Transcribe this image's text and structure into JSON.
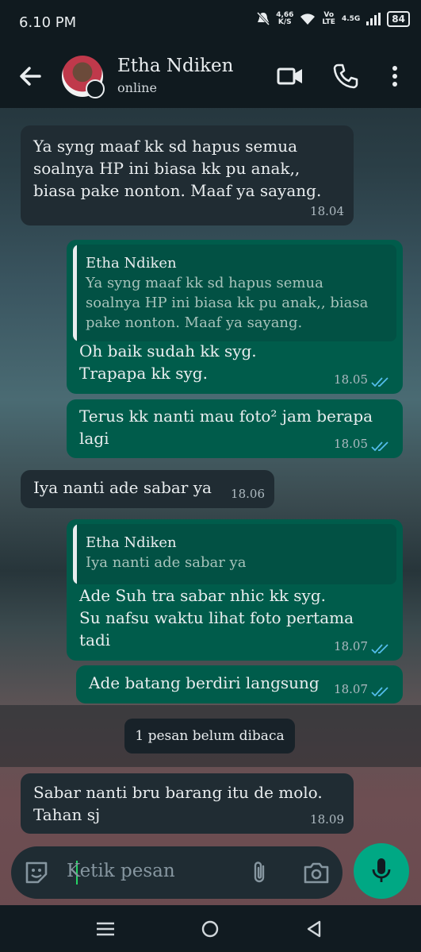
{
  "status_bar": {
    "time": "6.10 PM",
    "net_speed_value": "4,66",
    "net_speed_unit": "K/S",
    "vo_label": "Vo",
    "lte_label": "LTE",
    "signal_label": "4.5G",
    "battery": "84"
  },
  "header": {
    "contact_name": "Etha Ndiken",
    "contact_status": "online"
  },
  "messages": [
    {
      "direction": "in",
      "text": "Ya syng maaf kk sd hapus semua\nsoalnya HP ini biasa kk pu anak,,\nbiasa pake nonton. Maaf ya sayang.",
      "time": "18.04"
    },
    {
      "direction": "out",
      "quote_name": "Etha Ndiken",
      "quote_text": "Ya syng maaf kk sd hapus semua\nsoalnya HP ini biasa kk pu anak,, biasa\npake nonton. Maaf ya sayang.",
      "text": "Oh baik sudah kk syg.\nTrapapa kk syg.",
      "time": "18.05"
    },
    {
      "direction": "out",
      "text": "Terus kk nanti mau foto² jam berapa\nlagi",
      "time": "18.05"
    },
    {
      "direction": "in",
      "text": "Iya nanti ade sabar ya",
      "time": "18.06"
    },
    {
      "direction": "out",
      "quote_name": "Etha Ndiken",
      "quote_text": "Iya nanti ade sabar ya",
      "text": "Ade Suh tra sabar nhic kk syg.\nSu nafsu waktu lihat foto pertama\ntadi",
      "time": "18.07"
    },
    {
      "direction": "out",
      "text": "Ade batang berdiri langsung",
      "time": "18.07"
    },
    {
      "direction": "in",
      "text": "Sabar nanti bru barang itu de molo.\nTahan sj",
      "time": "18.09"
    }
  ],
  "unread_divider": "1 pesan belum dibaca",
  "composer": {
    "placeholder": "Ketik pesan"
  },
  "colors": {
    "incoming_bubble": "#202c33",
    "outgoing_bubble": "#005c4b",
    "accent": "#00a884",
    "read_ticks": "#53bdeb"
  }
}
